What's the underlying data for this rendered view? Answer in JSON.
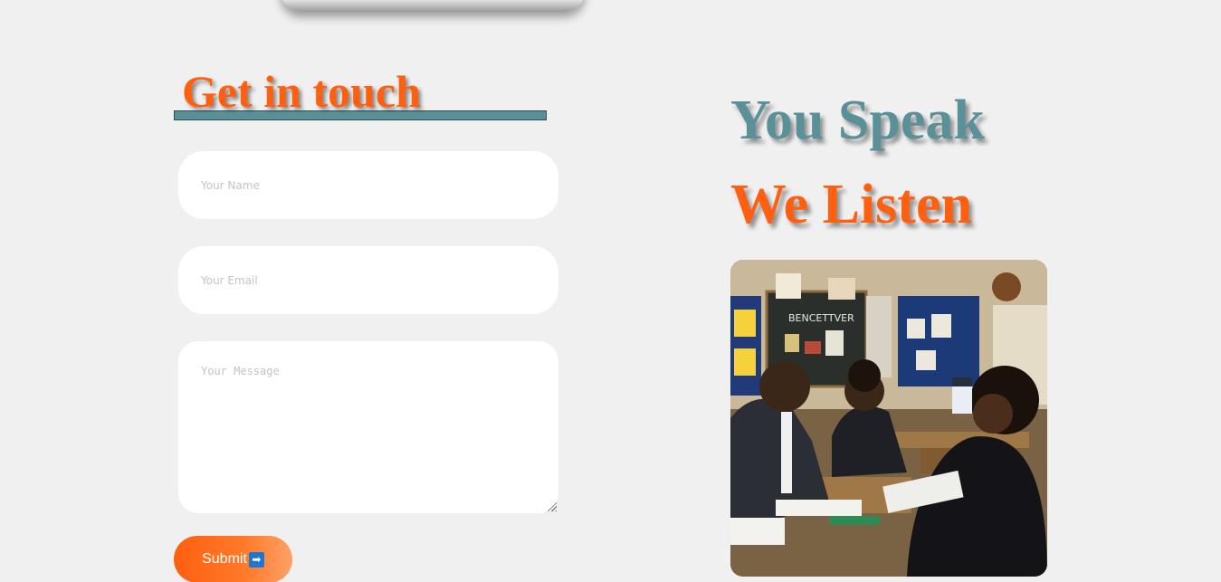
{
  "header": {
    "top_image": "image"
  },
  "contact_form": {
    "heading": "Get in touch",
    "name_placeholder": "Your Name",
    "email_placeholder": "Your Email",
    "message_placeholder": "Your Message",
    "submit_label": "Submit",
    "submit_icon": "➡"
  },
  "tagline": {
    "line1": "You Speak",
    "line2": "We Listen"
  },
  "photo": {
    "subject": "classroom meeting photo",
    "board_text": "BENCETTVER"
  },
  "colors": {
    "accent_orange": "#ff5f0f",
    "accent_teal": "#5a9098",
    "background": "#f0f0f0"
  }
}
